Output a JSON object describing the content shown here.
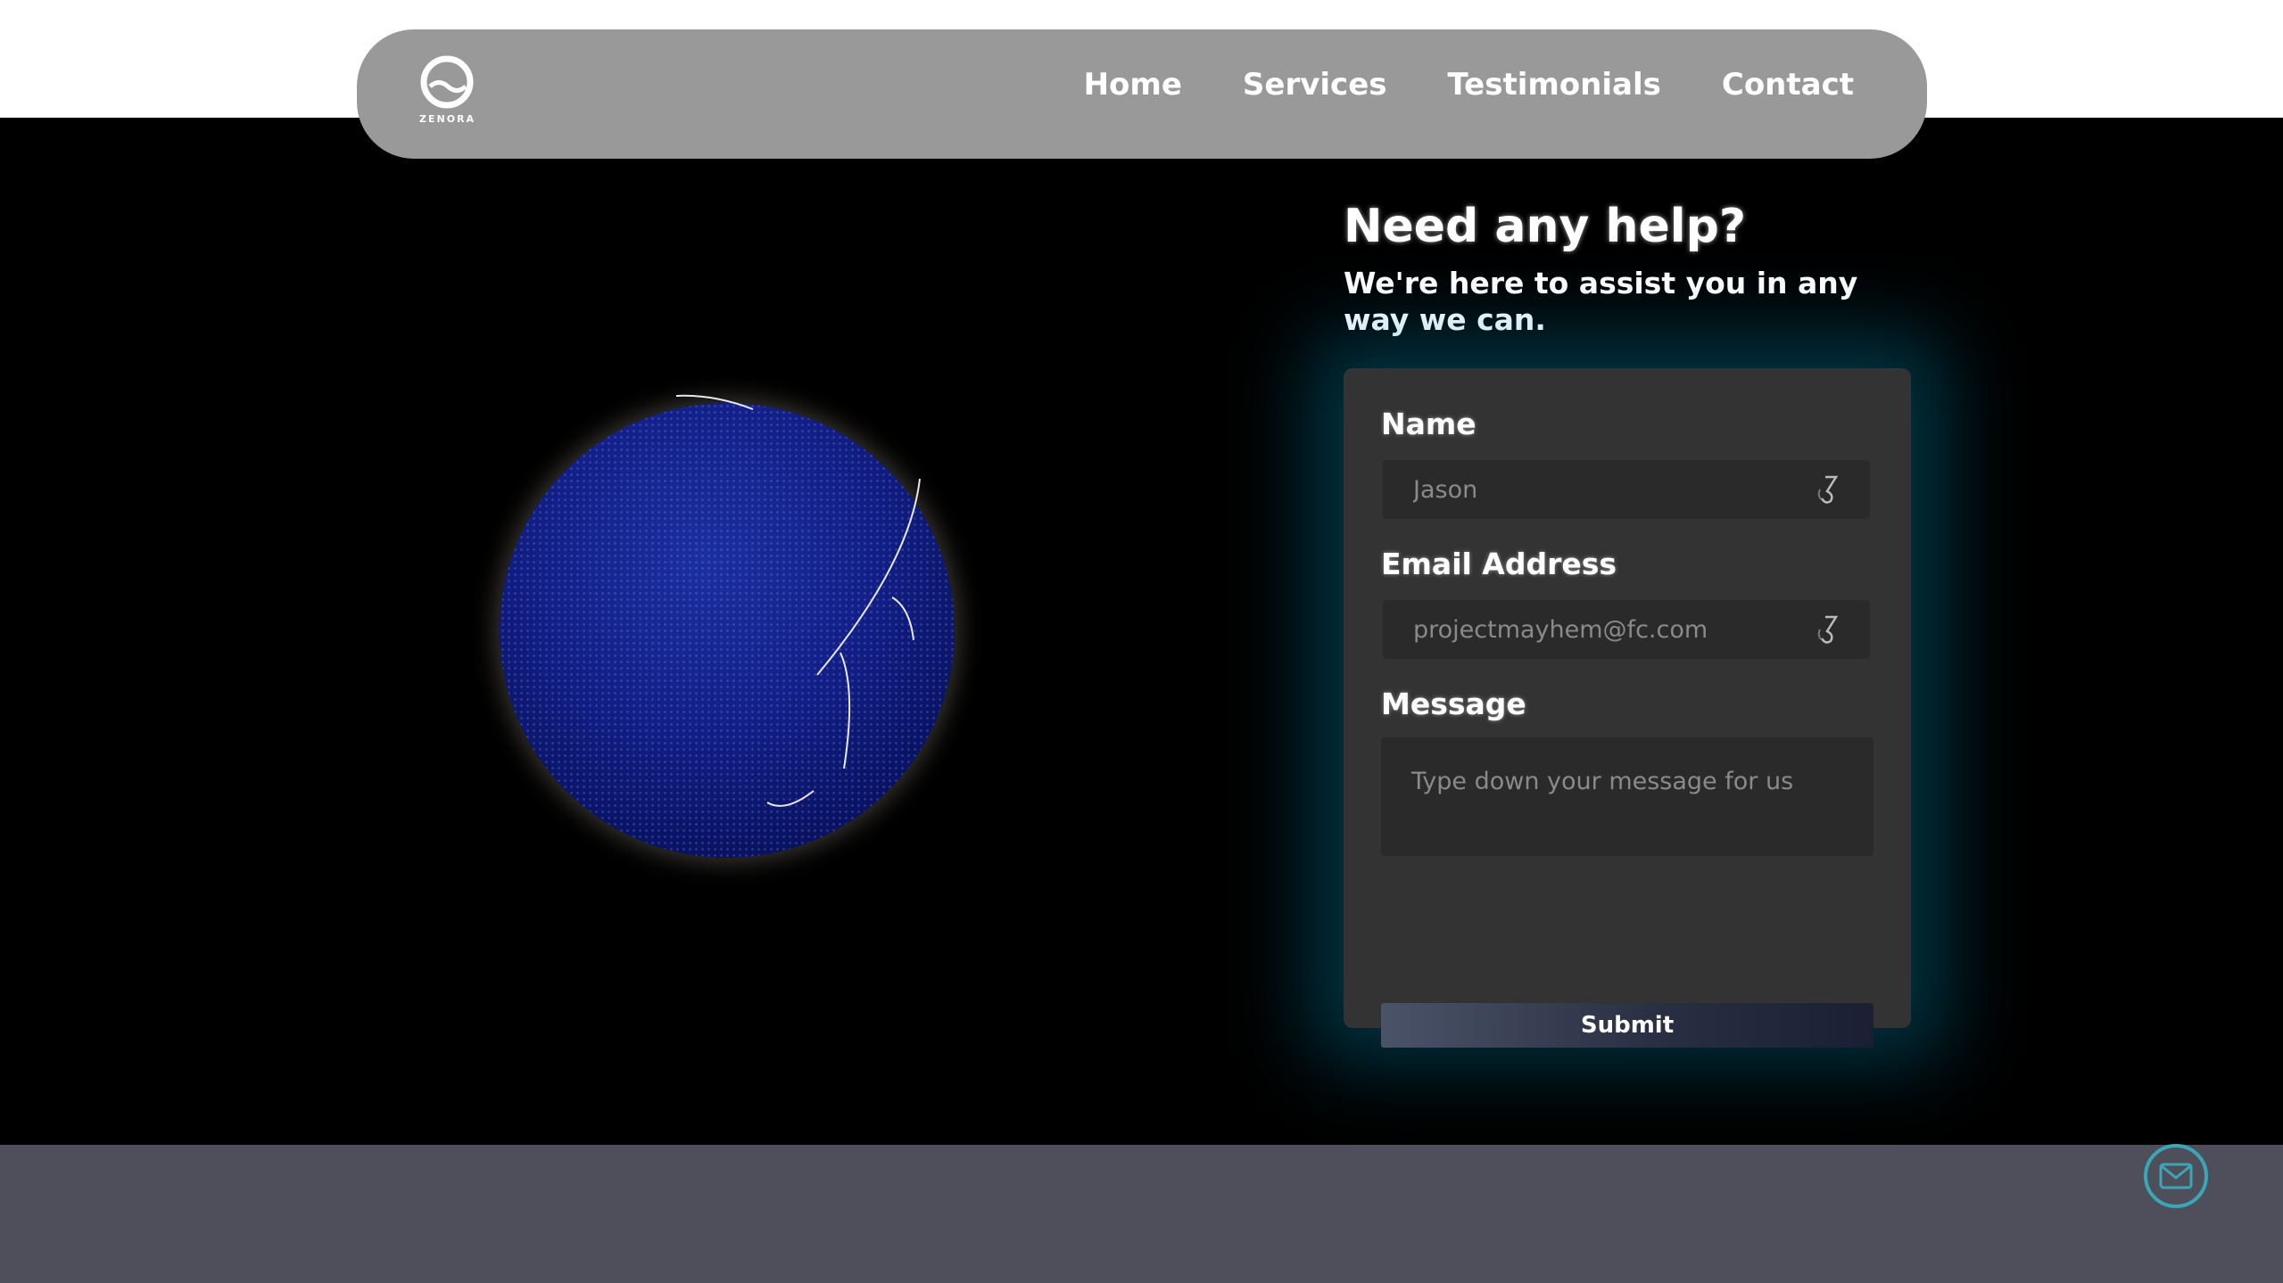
{
  "navbar": {
    "logo_text": "ZENORA",
    "links": [
      "Home",
      "Services",
      "Testimonials",
      "Contact"
    ]
  },
  "help": {
    "title": "Need any help?",
    "subtitle": "We're here to assist you in any way we can."
  },
  "form": {
    "name_label": "Name",
    "name_placeholder": "Jason",
    "email_label": "Email Address",
    "email_placeholder": "projectmayhem@fc.com",
    "message_label": "Message",
    "message_placeholder": "Type down your message for us",
    "submit_label": "Submit"
  },
  "icons": {
    "logo": "zenora-logo-icon",
    "field_action": "hook-icon",
    "mail": "mail-icon"
  },
  "colors": {
    "navbar": "#999999",
    "hero": "#000000",
    "card": "#333333",
    "glow": "#0096be",
    "footer": "#4f4f5b",
    "mail_accent": "#3ba6b6",
    "globe": "#13208a"
  }
}
